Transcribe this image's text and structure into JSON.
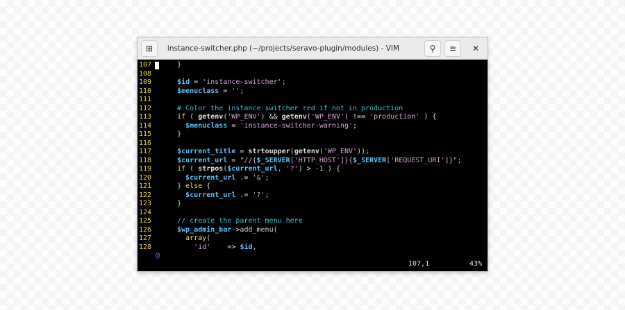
{
  "window": {
    "title": "instance-switcher.php (~/projects/seravo-plugin/modules) - VIM",
    "new_tab_icon": "⊞",
    "search_icon": "⚲",
    "menu_icon": "≡",
    "close_icon": "✕"
  },
  "editor": {
    "lines": [
      {
        "num": "107",
        "text": "    }"
      },
      {
        "num": "108",
        "text": ""
      },
      {
        "num": "109",
        "text": "    $id = 'instance-switcher';"
      },
      {
        "num": "110",
        "text": "    $menuclass = '';"
      },
      {
        "num": "111",
        "text": ""
      },
      {
        "num": "112",
        "text": "    # Color the instance switcher red if not in production"
      },
      {
        "num": "113",
        "text": "    if ( getenv('WP_ENV') && getenv('WP_ENV') !== 'production' ) {"
      },
      {
        "num": "114",
        "text": "      $menuclass = 'instance-switcher-warning';"
      },
      {
        "num": "115",
        "text": "    }"
      },
      {
        "num": "116",
        "text": ""
      },
      {
        "num": "117",
        "text": "    $current_title = strtoupper(getenv('WP_ENV'));"
      },
      {
        "num": "118",
        "text": "    $current_url = \"//{$_SERVER['HTTP_HOST']}{$_SERVER['REQUEST_URI']}\";"
      },
      {
        "num": "119",
        "text": "    if ( strpos($current_url, '?') > -1 ) {"
      },
      {
        "num": "120",
        "text": "      $current_url .= '&';"
      },
      {
        "num": "121",
        "text": "    } else {"
      },
      {
        "num": "122",
        "text": "      $current_url .= '?';"
      },
      {
        "num": "123",
        "text": "    }"
      },
      {
        "num": "124",
        "text": ""
      },
      {
        "num": "125",
        "text": "    // create the parent menu here"
      },
      {
        "num": "126",
        "text": "    $wp_admin_bar->add_menu("
      },
      {
        "num": "127",
        "text": "      array("
      },
      {
        "num": "128",
        "text": "        'id'    => $id,"
      }
    ],
    "continuation_marker": "@",
    "cursor_position": "107,1",
    "scroll_percent": "43%"
  }
}
